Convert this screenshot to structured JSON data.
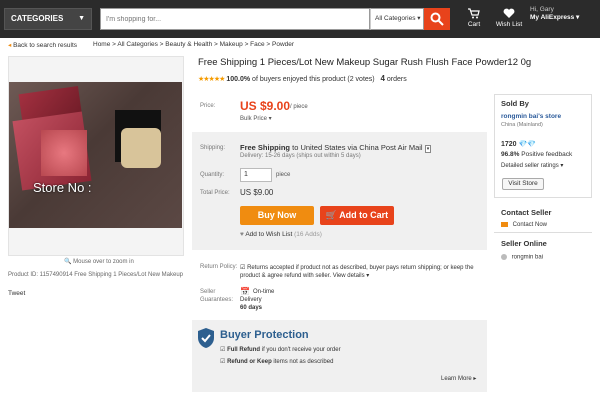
{
  "header": {
    "categories": "CATEGORIES",
    "search_placeholder": "I'm shopping for...",
    "search_category": "All Categories",
    "cart": "Cart",
    "wish_list": "Wish List",
    "greeting": "Hi, Gary",
    "my_aliexpress": "My AliExpress"
  },
  "breadcrumb": {
    "back": "Back to search results",
    "path": "Home > All Categories > Beauty & Health > Makeup > Face > Powder"
  },
  "gallery": {
    "watermark": "Store No :",
    "hint": "Mouse over to zoom in",
    "product_id": "Product ID: 1157490914 Free Shipping 1 Pieces/Lot New Makeup",
    "tweet": "Tweet"
  },
  "product": {
    "title": "Free Shipping 1 Pieces/Lot New Makeup Sugar Rush Flush Face Powder12 0g",
    "stars": "★★★★★",
    "rating_pct": "100.0%",
    "rating_text": "of buyers enjoyed this product (2 votes)",
    "orders_count": "4",
    "orders_label": "orders",
    "price_label": "Price:",
    "price": "US $9.00",
    "price_unit": "/ piece",
    "bulk": "Bulk Price ▾",
    "shipping_label": "Shipping:",
    "shipping_free": "Free Shipping",
    "shipping_to": "to United States via China Post Air Mail",
    "delivery": "Delivery: 15-26 days (ships out within 5 days)",
    "quantity_label": "Quantity:",
    "quantity_value": "1",
    "quantity_unit": "piece",
    "total_label": "Total Price:",
    "total_price": "US $9.00",
    "buy_now": "Buy Now",
    "add_to_cart": "Add to Cart",
    "add_wish": "Add to Wish List",
    "wish_count": "(16 Adds)",
    "return_label": "Return Policy:",
    "return_text": "Returns accepted if product not as described, buyer pays return shipping; or keep the product & agree refund with seller.",
    "view_details": "View details ▾",
    "guarantee_label_1": "Seller",
    "guarantee_label_2": "Guarantees:",
    "ontime": "On-time Delivery",
    "ontime_days": "60 days"
  },
  "protection": {
    "title": "Buyer Protection",
    "full_refund_bold": "Full Refund",
    "full_refund_rest": "if you don't receive your order",
    "keep_bold": "Refund or Keep",
    "keep_rest": "items not as described",
    "learn_more": "Learn More ▸"
  },
  "seller": {
    "sold_by": "Sold By",
    "store_name": "rongmin bai's store",
    "location": "China (Mainland)",
    "score": "1720",
    "diamonds": "💎💎",
    "feedback_pct": "96.8%",
    "feedback_label": "Positive feedback",
    "detailed": "Detailed seller ratings ▾",
    "visit_store": "Visit Store",
    "contact_heading": "Contact Seller",
    "contact_now": "Contact Now",
    "online_heading": "Seller Online",
    "online_name": "rongmin bai"
  },
  "colors": {
    "accent": "#e8431b",
    "buy_now": "#f08c10",
    "topbar": "#2b2b2b",
    "link": "#2a5a9a"
  }
}
